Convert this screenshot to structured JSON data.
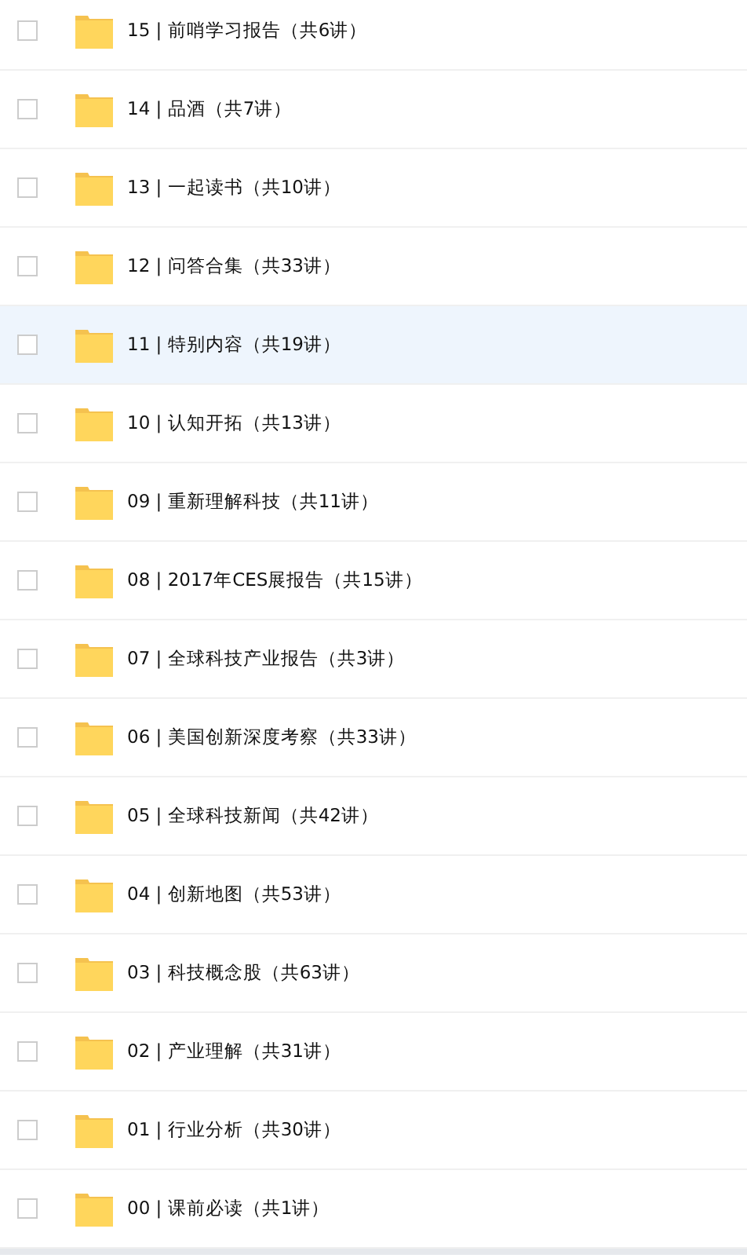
{
  "folders": [
    {
      "title": "15 | 前哨学习报告（共6讲）",
      "checked": false,
      "hovered": false
    },
    {
      "title": "14 | 品酒（共7讲）",
      "checked": false,
      "hovered": false
    },
    {
      "title": "13 | 一起读书（共10讲）",
      "checked": false,
      "hovered": false
    },
    {
      "title": "12 | 问答合集（共33讲）",
      "checked": false,
      "hovered": false
    },
    {
      "title": "11 | 特别内容（共19讲）",
      "checked": false,
      "hovered": true
    },
    {
      "title": "10 | 认知开拓（共13讲）",
      "checked": false,
      "hovered": false
    },
    {
      "title": "09 | 重新理解科技（共11讲）",
      "checked": false,
      "hovered": false
    },
    {
      "title": "08 | 2017年CES展报告（共15讲）",
      "checked": false,
      "hovered": false
    },
    {
      "title": "07 | 全球科技产业报告（共3讲）",
      "checked": false,
      "hovered": false
    },
    {
      "title": "06 | 美国创新深度考察（共33讲）",
      "checked": false,
      "hovered": false
    },
    {
      "title": "05 | 全球科技新闻（共42讲）",
      "checked": false,
      "hovered": false
    },
    {
      "title": "04 | 创新地图（共53讲）",
      "checked": false,
      "hovered": false
    },
    {
      "title": "03 | 科技概念股（共63讲）",
      "checked": false,
      "hovered": false
    },
    {
      "title": "02 | 产业理解（共31讲）",
      "checked": false,
      "hovered": false
    },
    {
      "title": "01 | 行业分析（共30讲）",
      "checked": false,
      "hovered": false
    },
    {
      "title": "00 | 课前必读（共1讲）",
      "checked": false,
      "hovered": false
    }
  ]
}
